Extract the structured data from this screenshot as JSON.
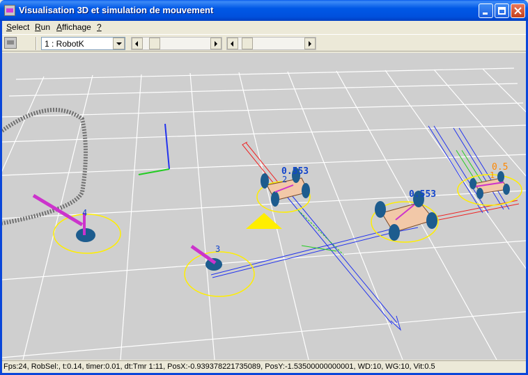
{
  "window": {
    "title": "Visualisation 3D et simulation de mouvement"
  },
  "menu": {
    "items": [
      {
        "label": "Select",
        "accel": "S"
      },
      {
        "label": "Run",
        "accel": "R"
      },
      {
        "label": "Affichage",
        "accel": "A"
      },
      {
        "label": "?",
        "accel": "?"
      }
    ]
  },
  "toolbar": {
    "robot_selected": "1 : RobotK"
  },
  "scene": {
    "labels": {
      "robot1_value": "0.553",
      "robot2_value": "0.553",
      "robot3_value": "0.5",
      "robot4_id": "4",
      "robot5_id": "3",
      "robot1_id": "2",
      "robot3_id": "1"
    },
    "colors": {
      "floor": "#cfcfcf",
      "grid": "#ffffff",
      "ring": "#ffee00",
      "wheel": "#1d5c8e",
      "path_blue": "#2233ee",
      "path_red": "#ee2222",
      "path_green": "#22cc22",
      "magenta": "#cc33cc",
      "label_blue": "#1144cc",
      "label_orange": "#ff8800",
      "marker": "#ffee00"
    }
  },
  "status": {
    "text": "Fps:24, RobSel:, t:0.14, timer:0.01, dt:Tmr 1:11, PosX:-0.939378221735089, PosY:-1.53500000000001, WD:10, WG:10, Vit:0.5"
  }
}
